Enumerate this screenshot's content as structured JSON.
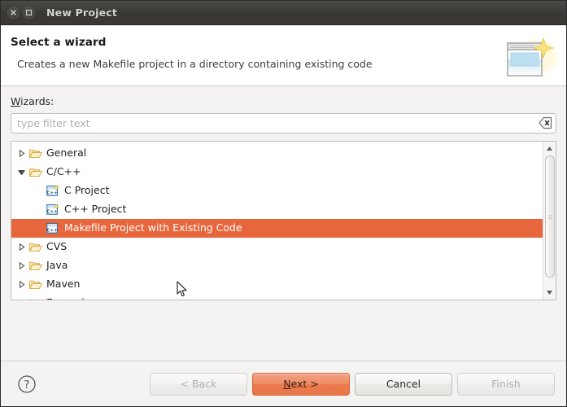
{
  "window": {
    "title": "New Project",
    "close_icon": "close-icon",
    "maximize_icon": "maximize-icon"
  },
  "header": {
    "title": "Select a wizard",
    "description": "Creates a new Makefile project in a directory containing existing code",
    "icon": "new-project-wizard-icon"
  },
  "main": {
    "wizards_label_mnemonic": "W",
    "wizards_label_rest": "izards:",
    "filter": {
      "value": "",
      "placeholder": "type filter text",
      "clear_icon": "clear-field-icon"
    },
    "tree": [
      {
        "label": "General",
        "level": 0,
        "icon": "folder-icon",
        "twisty": "collapsed",
        "selected": false
      },
      {
        "label": "C/C++",
        "level": 0,
        "icon": "folder-icon",
        "twisty": "expanded",
        "selected": false
      },
      {
        "label": "C Project",
        "level": 1,
        "icon": "c-project-icon",
        "twisty": "none",
        "selected": false
      },
      {
        "label": "C++ Project",
        "level": 1,
        "icon": "cpp-project-icon",
        "twisty": "none",
        "selected": false
      },
      {
        "label": "Makefile Project with Existing Code",
        "level": 1,
        "icon": "makefile-project-icon",
        "twisty": "none",
        "selected": true
      },
      {
        "label": "CVS",
        "level": 0,
        "icon": "folder-icon",
        "twisty": "collapsed",
        "selected": false
      },
      {
        "label": "Java",
        "level": 0,
        "icon": "folder-icon",
        "twisty": "collapsed",
        "selected": false
      },
      {
        "label": "Maven",
        "level": 0,
        "icon": "folder-icon",
        "twisty": "collapsed",
        "selected": false
      },
      {
        "label": "Example",
        "level": 0,
        "icon": "folder-icon",
        "twisty": "collapsed",
        "selected": false
      }
    ],
    "scrollbar": {
      "up_icon": "scroll-up-icon",
      "down_icon": "scroll-down-icon"
    }
  },
  "footer": {
    "help_icon": "help-icon",
    "back_label": "< Back",
    "next_mnemonic": "N",
    "next_prefix": "",
    "next_suffix": "ext >",
    "cancel_label": "Cancel",
    "finish_label": "Finish"
  },
  "colors": {
    "selection": "#e8663c",
    "default_button": "#e8764a",
    "titlebar": "#3c3b37",
    "window_bg": "#f4f3f2"
  }
}
